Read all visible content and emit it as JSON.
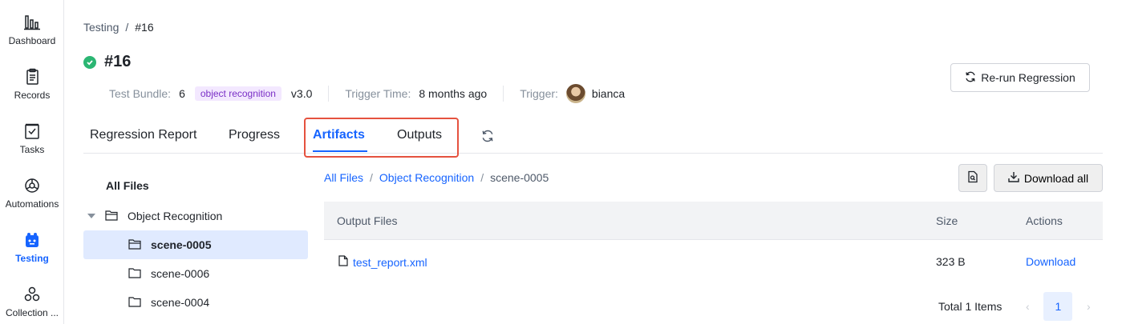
{
  "sidebar": {
    "items": [
      {
        "label": "Dashboard",
        "icon": "dashboard-icon"
      },
      {
        "label": "Records",
        "icon": "records-icon"
      },
      {
        "label": "Tasks",
        "icon": "tasks-icon"
      },
      {
        "label": "Automations",
        "icon": "automations-icon"
      },
      {
        "label": "Testing",
        "icon": "testing-icon",
        "active": true
      },
      {
        "label": "Collection ...",
        "icon": "collection-icon"
      }
    ]
  },
  "breadcrumb": {
    "root": "Testing",
    "sep": "/",
    "current": "#16"
  },
  "header": {
    "title": "#16",
    "status": "success",
    "test_bundle_label": "Test Bundle:",
    "test_bundle_count": "6",
    "test_bundle_tag": "object recognition",
    "test_bundle_version": "v3.0",
    "trigger_time_label": "Trigger Time:",
    "trigger_time_value": "8 months ago",
    "trigger_label": "Trigger:",
    "trigger_user": "bianca",
    "rerun_label": "Re-run Regression"
  },
  "tabs": [
    {
      "label": "Regression Report"
    },
    {
      "label": "Progress"
    },
    {
      "label": "Artifacts",
      "active": true
    },
    {
      "label": "Outputs"
    }
  ],
  "tree": {
    "title": "All Files",
    "root": "Object Recognition",
    "children": [
      "scene-0005",
      "scene-0006",
      "scene-0004"
    ],
    "selected": "scene-0005"
  },
  "file_breadcrumb": {
    "items": [
      "All Files",
      "Object Recognition"
    ],
    "current": "scene-0005",
    "sep": "/"
  },
  "actions": {
    "download_all": "Download all"
  },
  "table": {
    "columns": [
      "Output Files",
      "Size",
      "Actions"
    ],
    "rows": [
      {
        "name": "test_report.xml",
        "size": "323 B",
        "action": "Download"
      }
    ]
  },
  "pagination": {
    "total": "Total 1 Items",
    "current_page": "1"
  },
  "colors": {
    "accent": "#1664ff",
    "success": "#2bb673",
    "highlight": "#e5523f"
  }
}
